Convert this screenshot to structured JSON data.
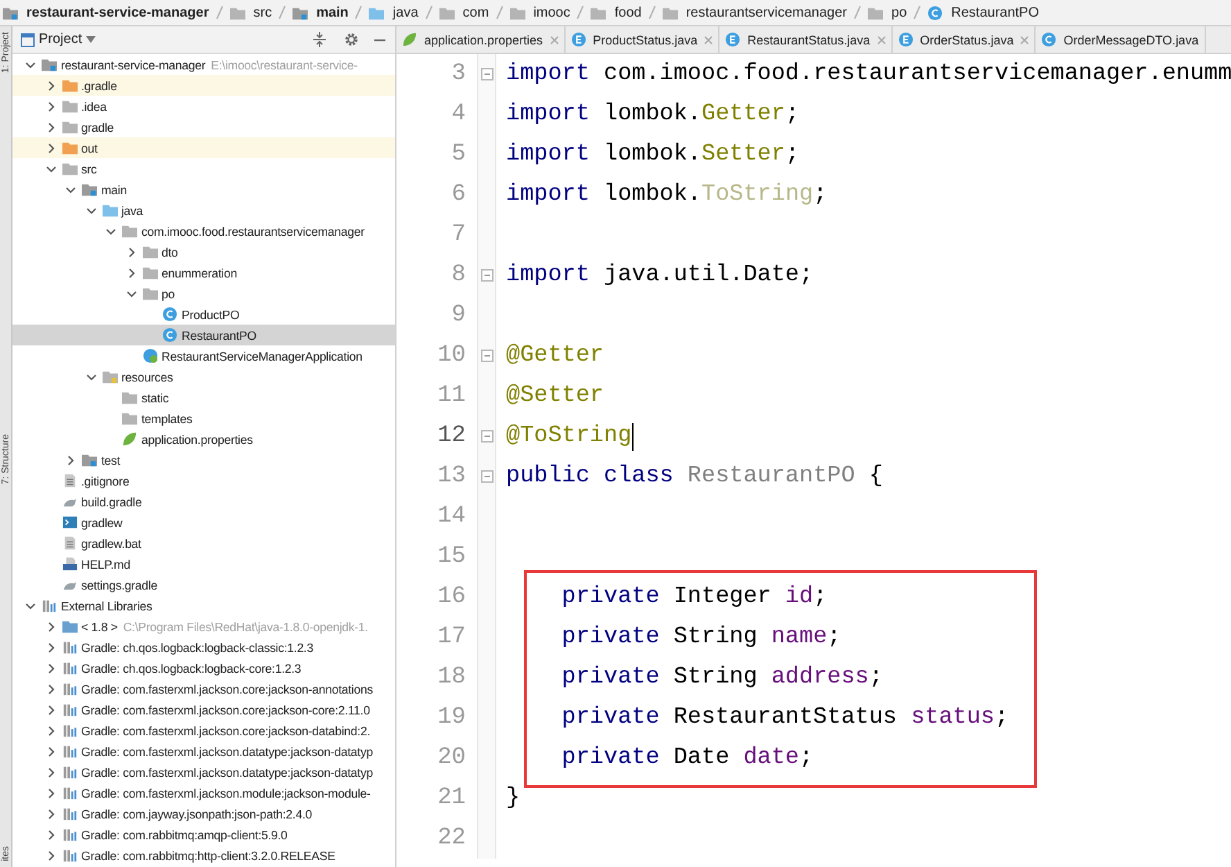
{
  "breadcrumb": [
    {
      "label": "restaurant-service-manager",
      "kind": "module",
      "bold": true
    },
    {
      "label": "src",
      "kind": "folder",
      "bold": false
    },
    {
      "label": "main",
      "kind": "source",
      "bold": true
    },
    {
      "label": "java",
      "kind": "java",
      "bold": false
    },
    {
      "label": "com",
      "kind": "folder",
      "bold": false
    },
    {
      "label": "imooc",
      "kind": "folder",
      "bold": false
    },
    {
      "label": "food",
      "kind": "folder",
      "bold": false
    },
    {
      "label": "restaurantservicemanager",
      "kind": "folder",
      "bold": false
    },
    {
      "label": "po",
      "kind": "folder",
      "bold": false
    },
    {
      "label": "RestaurantPO",
      "kind": "class",
      "bold": false
    }
  ],
  "side_strip": [
    "1: Project",
    "7: Structure",
    "ites"
  ],
  "project_panel": {
    "title": "Project",
    "tree": [
      {
        "label": "restaurant-service-manager",
        "hint": "E:\\imooc\\restaurant-service-",
        "kind": "module",
        "selected": false,
        "expanded": true,
        "children": [
          {
            "label": ".gradle",
            "kind": "excluded",
            "selected": false,
            "expanded": false
          },
          {
            "label": ".idea",
            "kind": "folder",
            "selected": false,
            "expanded": false
          },
          {
            "label": "gradle",
            "kind": "folder",
            "selected": false,
            "expanded": false
          },
          {
            "label": "out",
            "kind": "excluded",
            "selected": false,
            "expanded": false
          },
          {
            "label": "src",
            "kind": "folder",
            "selected": false,
            "expanded": true,
            "children": [
              {
                "label": "main",
                "kind": "source",
                "selected": false,
                "expanded": true,
                "children": [
                  {
                    "label": "java",
                    "kind": "java",
                    "selected": false,
                    "expanded": true,
                    "children": [
                      {
                        "label": "com.imooc.food.restaurantservicemanager",
                        "kind": "package",
                        "selected": false,
                        "expanded": true,
                        "children": [
                          {
                            "label": "dto",
                            "kind": "package",
                            "selected": false,
                            "expanded": false
                          },
                          {
                            "label": "enummeration",
                            "kind": "package",
                            "selected": false,
                            "expanded": false
                          },
                          {
                            "label": "po",
                            "kind": "package",
                            "selected": false,
                            "expanded": true,
                            "children": [
                              {
                                "label": "ProductPO",
                                "kind": "class",
                                "selected": false
                              },
                              {
                                "label": "RestaurantPO",
                                "kind": "class",
                                "selected": true
                              }
                            ]
                          },
                          {
                            "label": "RestaurantServiceManagerApplication",
                            "kind": "spring",
                            "selected": false
                          }
                        ]
                      }
                    ]
                  },
                  {
                    "label": "resources",
                    "kind": "resources",
                    "selected": false,
                    "expanded": true,
                    "children": [
                      {
                        "label": "static",
                        "kind": "folder",
                        "selected": false
                      },
                      {
                        "label": "templates",
                        "kind": "folder",
                        "selected": false
                      },
                      {
                        "label": "application.properties",
                        "kind": "properties",
                        "selected": false
                      }
                    ]
                  }
                ]
              },
              {
                "label": "test",
                "kind": "source",
                "selected": false,
                "expanded": false
              }
            ]
          },
          {
            "label": ".gitignore",
            "kind": "file",
            "selected": false
          },
          {
            "label": "build.gradle",
            "kind": "gradle",
            "selected": false
          },
          {
            "label": "gradlew",
            "kind": "script",
            "selected": false
          },
          {
            "label": "gradlew.bat",
            "kind": "file",
            "selected": false
          },
          {
            "label": "HELP.md",
            "kind": "markdown",
            "selected": false
          },
          {
            "label": "settings.gradle",
            "kind": "gradle",
            "selected": false
          }
        ]
      },
      {
        "label": "External Libraries",
        "kind": "library",
        "selected": false,
        "expanded": true,
        "children": [
          {
            "label": "< 1.8 >",
            "hint": "C:\\Program Files\\RedHat\\java-1.8.0-openjdk-1.",
            "kind": "jdk",
            "selected": false,
            "expanded": false
          },
          {
            "label": "Gradle: ch.qos.logback:logback-classic:1.2.3",
            "kind": "library",
            "selected": false,
            "expanded": false
          },
          {
            "label": "Gradle: ch.qos.logback:logback-core:1.2.3",
            "kind": "library",
            "selected": false,
            "expanded": false
          },
          {
            "label": "Gradle: com.fasterxml.jackson.core:jackson-annotations",
            "kind": "library",
            "selected": false,
            "expanded": false
          },
          {
            "label": "Gradle: com.fasterxml.jackson.core:jackson-core:2.11.0",
            "kind": "library",
            "selected": false,
            "expanded": false
          },
          {
            "label": "Gradle: com.fasterxml.jackson.core:jackson-databind:2.",
            "kind": "library",
            "selected": false,
            "expanded": false
          },
          {
            "label": "Gradle: com.fasterxml.jackson.datatype:jackson-datatyp",
            "kind": "library",
            "selected": false,
            "expanded": false
          },
          {
            "label": "Gradle: com.fasterxml.jackson.datatype:jackson-datatyp",
            "kind": "library",
            "selected": false,
            "expanded": false
          },
          {
            "label": "Gradle: com.fasterxml.jackson.module:jackson-module-",
            "kind": "library",
            "selected": false,
            "expanded": false
          },
          {
            "label": "Gradle: com.jayway.jsonpath:json-path:2.4.0",
            "kind": "library",
            "selected": false,
            "expanded": false
          },
          {
            "label": "Gradle: com.rabbitmq:amqp-client:5.9.0",
            "kind": "library",
            "selected": false,
            "expanded": false
          },
          {
            "label": "Gradle: com.rabbitmq:http-client:3.2.0.RELEASE",
            "kind": "library",
            "selected": false,
            "expanded": false
          }
        ]
      }
    ]
  },
  "editor_tabs": [
    {
      "label": "application.properties",
      "kind": "properties",
      "closable": true
    },
    {
      "label": "ProductStatus.java",
      "kind": "enum",
      "closable": true
    },
    {
      "label": "RestaurantStatus.java",
      "kind": "enum",
      "closable": true
    },
    {
      "label": "OrderStatus.java",
      "kind": "enum",
      "closable": true
    },
    {
      "label": "OrderMessageDTO.java",
      "kind": "class",
      "closable": false
    }
  ],
  "code": [
    {
      "number": "3",
      "fold": true,
      "boxed": false,
      "caret": false,
      "indented": false,
      "tokens": [
        {
          "kind": "keyword",
          "text": "import"
        },
        {
          "kind": "plain",
          "text": " com.imooc.food.restaurantservicemanager.enumm"
        }
      ]
    },
    {
      "number": "4",
      "fold": false,
      "boxed": false,
      "caret": false,
      "indented": false,
      "tokens": [
        {
          "kind": "keyword",
          "text": "import"
        },
        {
          "kind": "plain",
          "text": " lombok."
        },
        {
          "kind": "annotation",
          "text": "Getter"
        },
        {
          "kind": "plain",
          "text": ";"
        }
      ]
    },
    {
      "number": "5",
      "fold": false,
      "boxed": false,
      "caret": false,
      "indented": false,
      "tokens": [
        {
          "kind": "keyword",
          "text": "import"
        },
        {
          "kind": "plain",
          "text": " lombok."
        },
        {
          "kind": "annotation",
          "text": "Setter"
        },
        {
          "kind": "plain",
          "text": ";"
        }
      ]
    },
    {
      "number": "6",
      "fold": false,
      "boxed": false,
      "caret": false,
      "indented": false,
      "tokens": [
        {
          "kind": "keyword",
          "text": "import"
        },
        {
          "kind": "plain",
          "text": " lombok."
        },
        {
          "kind": "unused",
          "text": "ToString"
        },
        {
          "kind": "plain",
          "text": ";"
        }
      ]
    },
    {
      "number": "7",
      "fold": false,
      "caret": false
    },
    {
      "number": "8",
      "fold": true,
      "boxed": false,
      "caret": false,
      "indented": false,
      "tokens": [
        {
          "kind": "keyword",
          "text": "import"
        },
        {
          "kind": "plain",
          "text": " java.util.Date;"
        }
      ]
    },
    {
      "number": "9",
      "fold": false,
      "caret": false
    },
    {
      "number": "10",
      "fold": true,
      "boxed": false,
      "caret": false,
      "indented": false,
      "tokens": [
        {
          "kind": "annotation",
          "text": "@Getter"
        }
      ]
    },
    {
      "number": "11",
      "fold": false,
      "boxed": false,
      "caret": false,
      "indented": false,
      "tokens": [
        {
          "kind": "annotation",
          "text": "@Setter"
        }
      ]
    },
    {
      "number": "12",
      "fold": true,
      "boxed": false,
      "caret": true,
      "indented": false,
      "tokens": [
        {
          "kind": "annotation",
          "text": "@ToString"
        }
      ]
    },
    {
      "number": "13",
      "fold": true,
      "boxed": false,
      "caret": false,
      "indented": false,
      "tokens": [
        {
          "kind": "keyword",
          "text": "public class"
        },
        {
          "kind": "declared",
          "text": " RestaurantPO"
        },
        {
          "kind": "plain",
          "text": " {"
        }
      ]
    },
    {
      "number": "14",
      "fold": false,
      "caret": false
    },
    {
      "number": "15",
      "fold": false,
      "caret": false
    },
    {
      "number": "16",
      "fold": false,
      "boxed": true,
      "caret": false,
      "indented": true,
      "tokens": [
        {
          "kind": "keyword",
          "text": "private"
        },
        {
          "kind": "plain",
          "text": " Integer "
        },
        {
          "kind": "field",
          "text": "id"
        },
        {
          "kind": "plain",
          "text": ";"
        }
      ]
    },
    {
      "number": "17",
      "fold": false,
      "boxed": true,
      "caret": false,
      "indented": true,
      "tokens": [
        {
          "kind": "keyword",
          "text": "private"
        },
        {
          "kind": "plain",
          "text": " String "
        },
        {
          "kind": "field",
          "text": "name"
        },
        {
          "kind": "plain",
          "text": ";"
        }
      ]
    },
    {
      "number": "18",
      "fold": false,
      "boxed": true,
      "caret": false,
      "indented": true,
      "tokens": [
        {
          "kind": "keyword",
          "text": "private"
        },
        {
          "kind": "plain",
          "text": " String "
        },
        {
          "kind": "field",
          "text": "address"
        },
        {
          "kind": "plain",
          "text": ";"
        }
      ]
    },
    {
      "number": "19",
      "fold": false,
      "boxed": true,
      "caret": false,
      "indented": true,
      "tokens": [
        {
          "kind": "keyword",
          "text": "private"
        },
        {
          "kind": "plain",
          "text": " RestaurantStatus "
        },
        {
          "kind": "field",
          "text": "status"
        },
        {
          "kind": "plain",
          "text": ";"
        }
      ]
    },
    {
      "number": "20",
      "fold": false,
      "boxed": true,
      "caret": false,
      "indented": true,
      "tokens": [
        {
          "kind": "keyword",
          "text": "private"
        },
        {
          "kind": "plain",
          "text": " Date "
        },
        {
          "kind": "field",
          "text": "date"
        },
        {
          "kind": "plain",
          "text": ";"
        }
      ]
    },
    {
      "number": "21",
      "fold": false,
      "boxed": false,
      "caret": false,
      "indented": false,
      "tokens": [
        {
          "kind": "plain",
          "text": "}"
        }
      ]
    },
    {
      "number": "22",
      "fold": false,
      "caret": false
    }
  ]
}
